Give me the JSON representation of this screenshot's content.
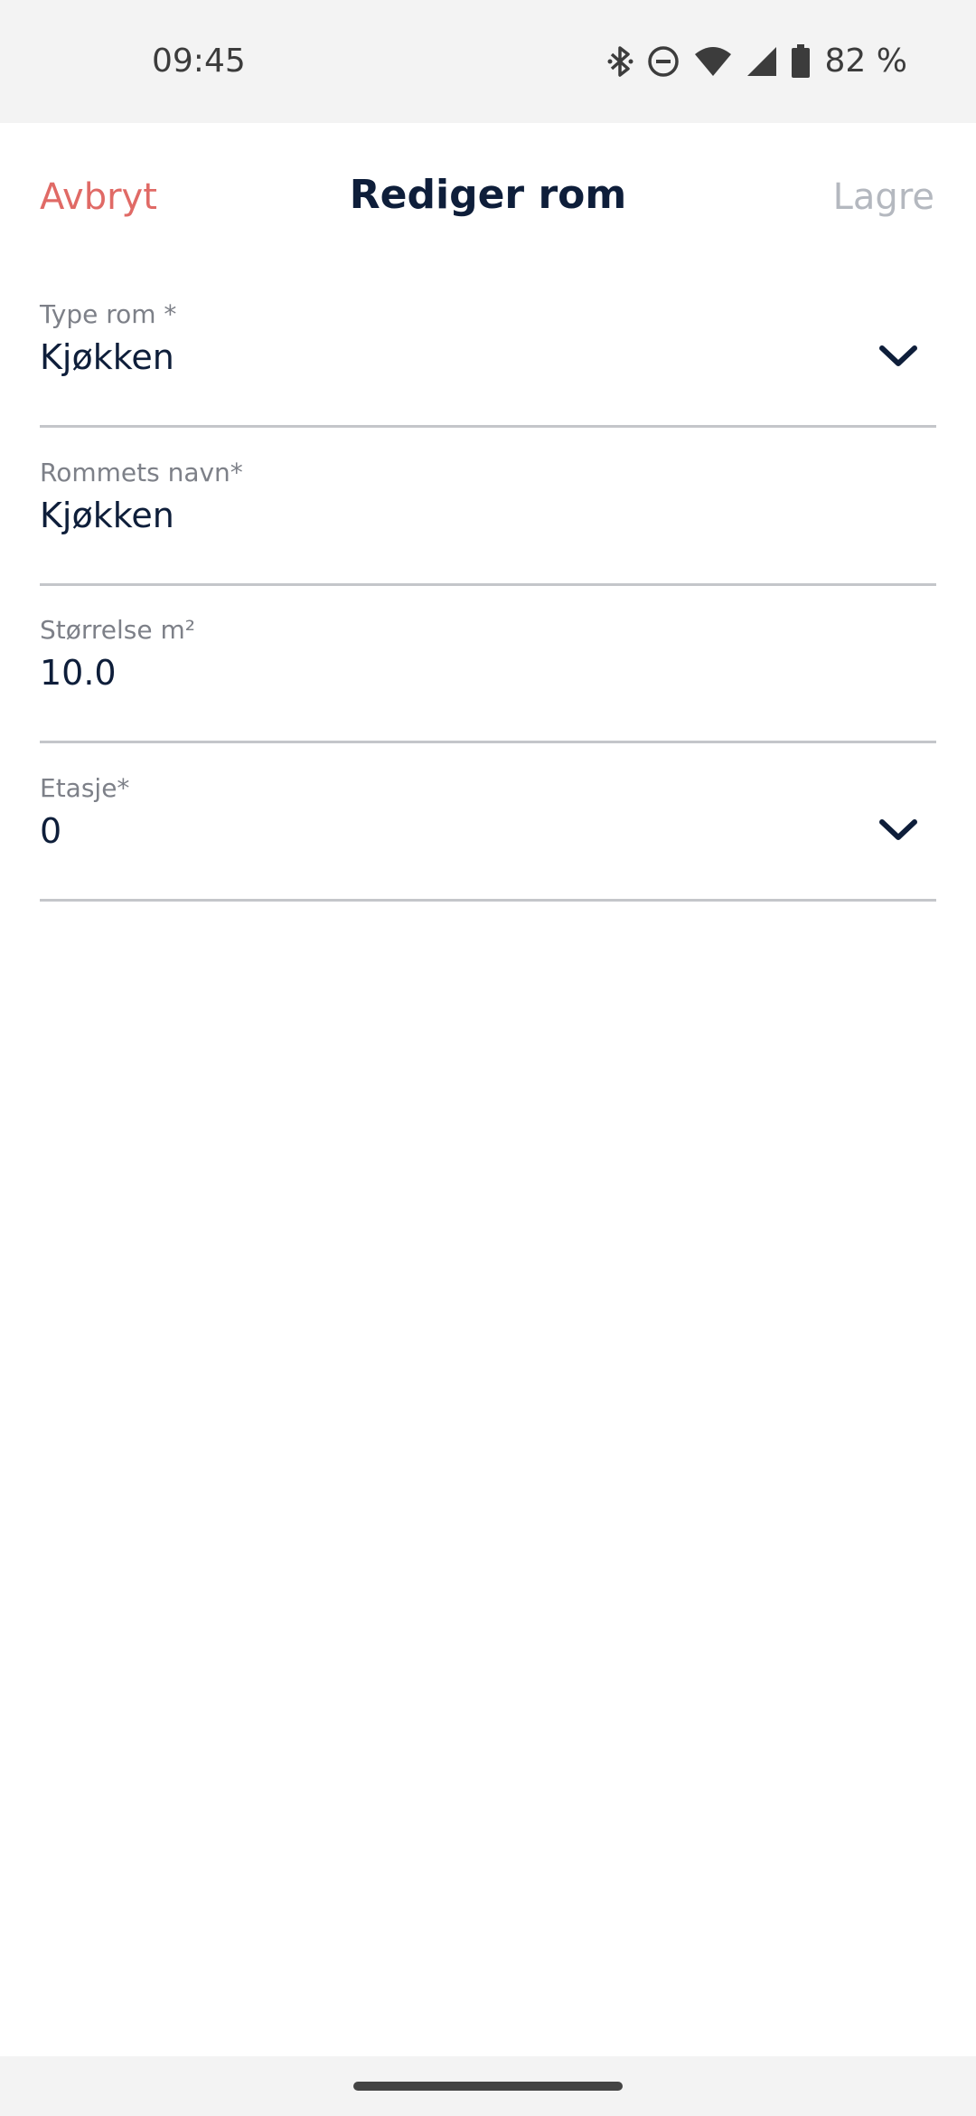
{
  "status_bar": {
    "time": "09:45",
    "icons": [
      "bluetooth-icon",
      "do-not-disturb-icon",
      "wifi-icon",
      "signal-icon",
      "battery-icon"
    ],
    "battery": "82 %"
  },
  "header": {
    "cancel_label": "Avbryt",
    "title": "Rediger rom",
    "save_label": "Lagre"
  },
  "form": {
    "room_type": {
      "label": "Type rom *",
      "value": "Kjøkken"
    },
    "room_name": {
      "label": "Rommets navn*",
      "value": "Kjøkken"
    },
    "size": {
      "label": "Størrelse m²",
      "value": "10.0"
    },
    "floor": {
      "label": "Etasje*",
      "value": "0"
    }
  },
  "colors": {
    "accent_cancel": "#e06a66",
    "title": "#0e1e3a",
    "disabled": "#b4b8bf",
    "label": "#7d8088",
    "divider": "#c4c6ca"
  }
}
